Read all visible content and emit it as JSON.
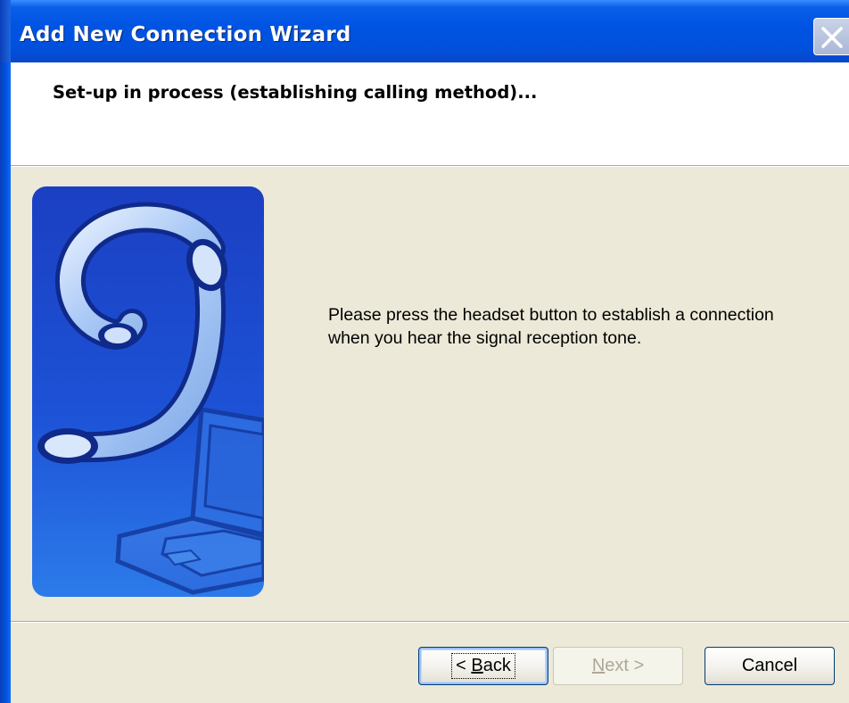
{
  "window": {
    "title": "Add New Connection Wizard",
    "close_icon": "close-icon"
  },
  "header": {
    "title": "Set-up in process (establishing calling method)..."
  },
  "illustration": {
    "icon": "headset-laptop-illustration"
  },
  "message": {
    "line1": "Please press the headset button to establish a connection",
    "line2": "when you hear the signal reception tone."
  },
  "buttons": {
    "back_prefix": "< ",
    "back_accel": "B",
    "back_rest": "ack",
    "next_accel": "N",
    "next_rest": "ext >",
    "cancel": "Cancel"
  },
  "colors": {
    "titlebar": "#0054E3",
    "dialog_bg": "#ECE9D8",
    "illustration_bg": "#1E44C8"
  }
}
